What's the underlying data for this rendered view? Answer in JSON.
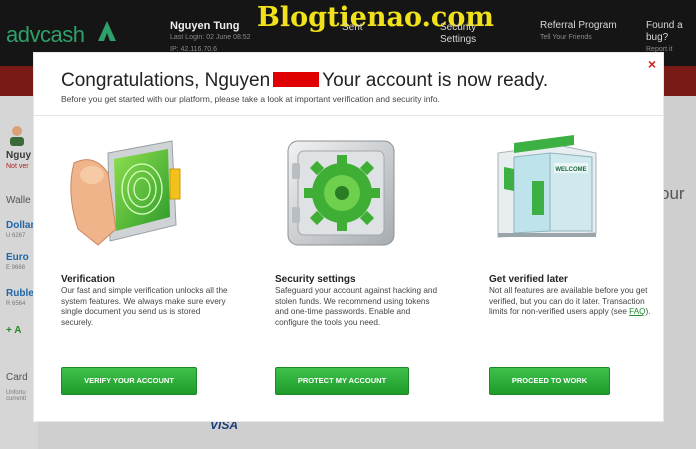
{
  "background": {
    "logo_text": "advcash",
    "watermark": "Blogtienao.com",
    "user_name": "Nguyen Tung",
    "last_login": "Last Login: 02 June 08:52",
    "ip_line": "IP: 42.116.70.6",
    "nav_sent": "Sent",
    "nav_security": "Security\nSettings",
    "nav_referral": "Referral Program",
    "nav_referral_sub": "Tell Your Friends",
    "nav_bug": "Found a\nbug?",
    "nav_bug_sub": "Report it",
    "side_name": "Nguy",
    "side_status": "Not ver",
    "side_wallets": "Walle",
    "wallet_1": "Dollar",
    "wallet_1_id": "U 6267",
    "wallet_2": "Euro",
    "wallet_2_id": "E 9668",
    "wallet_3": "Ruble",
    "wallet_3_id": "R 6564",
    "add": "+ A",
    "cards": "Card",
    "cards_sub": "Unfortu\ncurrentl",
    "right_text": "our",
    "visa": "VISA"
  },
  "modal": {
    "title_before": "Congratulations, Nguyen",
    "title_after": "Your account is now ready.",
    "subtitle": "Before you get started with our platform, please take a look at important verification and security info.",
    "close": "×",
    "features": [
      {
        "title": "Verification",
        "body": "Our fast and simple verification unlocks all the system features. We always make sure every single document you send us is stored securely.",
        "button": "VERIFY YOUR ACCOUNT"
      },
      {
        "title": "Security settings",
        "body": "Safeguard your account against hacking and stolen funds. We recommend using tokens and one-time passwords. Enable and configure the tools you need.",
        "button": "PROTECT MY ACCOUNT"
      },
      {
        "title": "Get verified later",
        "body_before": "Not all features are available before you get verified, but you can do it later. Transaction limits for non-verified users apply (see ",
        "link": "FAQ",
        "body_after": ").",
        "button": "PROCEED TO WORK"
      }
    ],
    "welcome_sign": "WELCOME"
  },
  "colors": {
    "accent_green": "#2aa836",
    "close_red": "#cc2222",
    "redaction": "#e00000"
  }
}
